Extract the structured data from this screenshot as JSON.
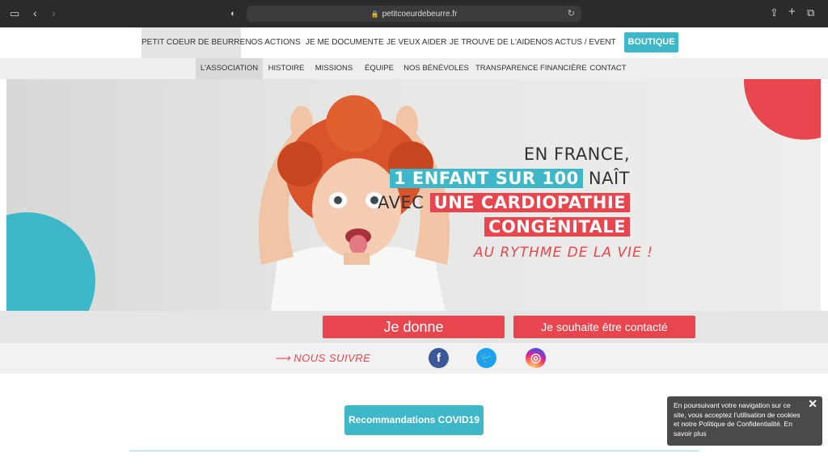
{
  "browser": {
    "url": "petitcoeurdebeurre.fr",
    "icons": [
      "sidebar-icon",
      "back-icon",
      "forward-icon",
      "shield-icon",
      "lock-icon",
      "reload-icon",
      "share-icon",
      "new-tab-icon",
      "tabs-icon"
    ]
  },
  "topnav": {
    "items": [
      {
        "label": "PETIT COEUR DE BEURRE",
        "active": true
      },
      {
        "label": "NOS ACTIONS"
      },
      {
        "label": "JE ME DOCUMENTE"
      },
      {
        "label": "JE VEUX AIDER"
      },
      {
        "label": "JE TROUVE DE L'AIDE"
      },
      {
        "label": "NOS ACTUS / EVENT"
      }
    ],
    "shop_label": "BOUTIQUE"
  },
  "subnav": {
    "items": [
      {
        "label": "L'ASSOCIATION",
        "active": true
      },
      {
        "label": "HISTOIRE"
      },
      {
        "label": "MISSIONS"
      },
      {
        "label": "ÉQUIPE"
      },
      {
        "label": "NOS BÉNÉVOLES"
      },
      {
        "label": "TRANSPARENCE FINANCIÈRE"
      },
      {
        "label": "CONTACT"
      }
    ]
  },
  "hero": {
    "line1": "EN FRANCE,",
    "line2_highlight": "1 ENFANT SUR 100",
    "line2_rest": "NAÎT",
    "line3_pre": "AVEC",
    "line3_highlight": "UNE CARDIOPATHIE",
    "line4_highlight": "CONGÉNITALE",
    "tagline": "AU RYTHME DE LA VIE !"
  },
  "cta": {
    "donate_label": "Je donne",
    "contact_label": "Je souhaite être contacté"
  },
  "social": {
    "follow_label": "NOUS SUIVRE",
    "icons": [
      "facebook-icon",
      "twitter-icon",
      "instagram-icon"
    ]
  },
  "covid_label": "Recommandations COVID19",
  "cookie": {
    "text": "En poursuivant votre navigation sur ce site, vous acceptez l'utilisation de cookies et notre Politique de Confidentialité. En savoir plus",
    "close": "✕"
  },
  "colors": {
    "accent_blue": "#3eb7c8",
    "accent_red": "#e8464f",
    "chrome_bg": "#2b2b2d"
  }
}
